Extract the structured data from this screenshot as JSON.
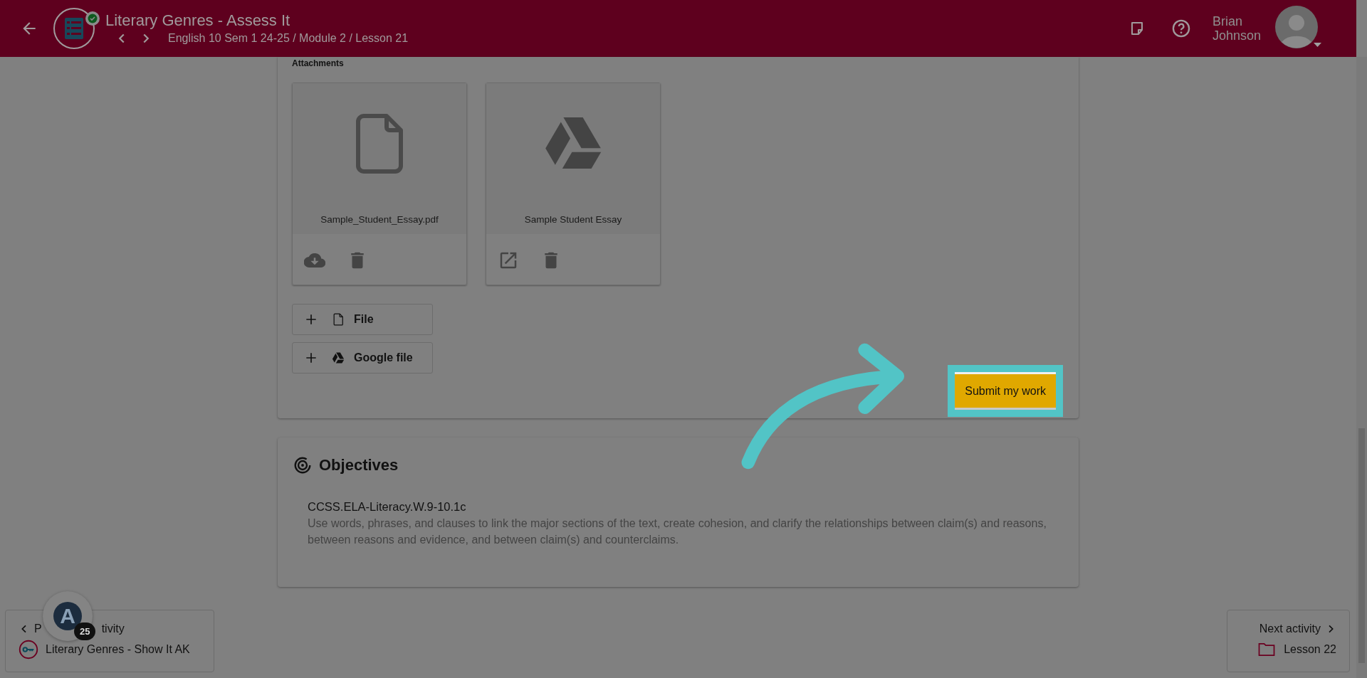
{
  "header": {
    "title": "Literary Genres - Assess It",
    "breadcrumb": "English 10 Sem 1 24-25 / Module 2 / Lesson 21",
    "completed": true,
    "user_name": [
      "Brian",
      "Johnson"
    ]
  },
  "attachments": {
    "label": "Attachments",
    "items": [
      {
        "name": "Sample_Student_Essay.pdf",
        "kind": "file"
      },
      {
        "name": "Sample Student Essay",
        "kind": "drive"
      }
    ],
    "add_buttons": [
      {
        "label": "File",
        "kind": "file"
      },
      {
        "label": "Google file",
        "kind": "drive"
      }
    ],
    "submit": "Submit my work"
  },
  "objectives": {
    "title": "Objectives",
    "items": [
      {
        "code": "CCSS.ELA-Literacy.W.9-10.1c",
        "description": "Use words, phrases, and clauses to link the major sections of the text, create cohesion, and clarify the relationships between claim(s) and reasons, between reasons and evidence, and between claim(s) and counterclaims."
      }
    ]
  },
  "previous": {
    "label_parts": [
      "P",
      "tivity"
    ],
    "title": "Literary Genres - Show It AK"
  },
  "assistant": {
    "logo": "A",
    "badge": "25"
  },
  "next": {
    "label": "Next activity",
    "title": "Lesson 22"
  }
}
